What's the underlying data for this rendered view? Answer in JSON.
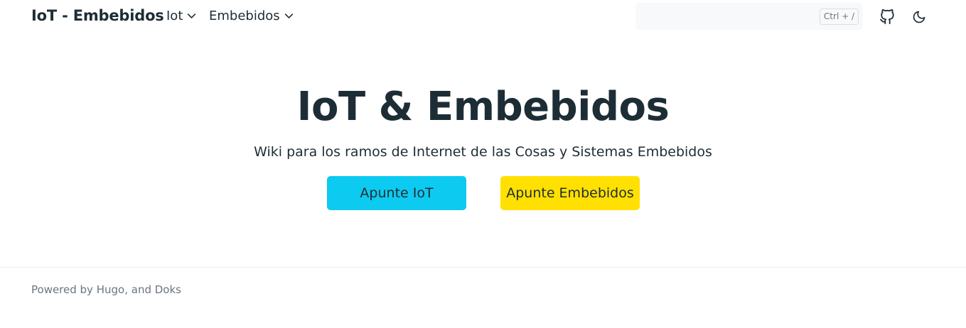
{
  "header": {
    "brand": "IoT - Embebidos",
    "nav": [
      {
        "label": "Iot"
      },
      {
        "label": "Embebidos"
      }
    ],
    "search": {
      "placeholder": "",
      "shortcut": "Ctrl + /"
    },
    "icons": [
      "github-icon",
      "moon-icon",
      "chevron-down-icon"
    ]
  },
  "hero": {
    "title": "IoT & Embebidos",
    "subtitle": "Wiki para los ramos de Internet de las Cosas y Sistemas Embebidos",
    "buttons": [
      {
        "label": "Apunte IoT",
        "color": "#0dcaf0"
      },
      {
        "label": "Apunte Embebidos",
        "color": "#ffe000"
      }
    ]
  },
  "footer": {
    "prefix": "Powered by ",
    "link1": "Hugo",
    "mid": ", and ",
    "link2": "Doks"
  },
  "colors": {
    "text": "#1d2d35",
    "muted": "#6c757d",
    "search_bg": "#f8f9fa"
  }
}
